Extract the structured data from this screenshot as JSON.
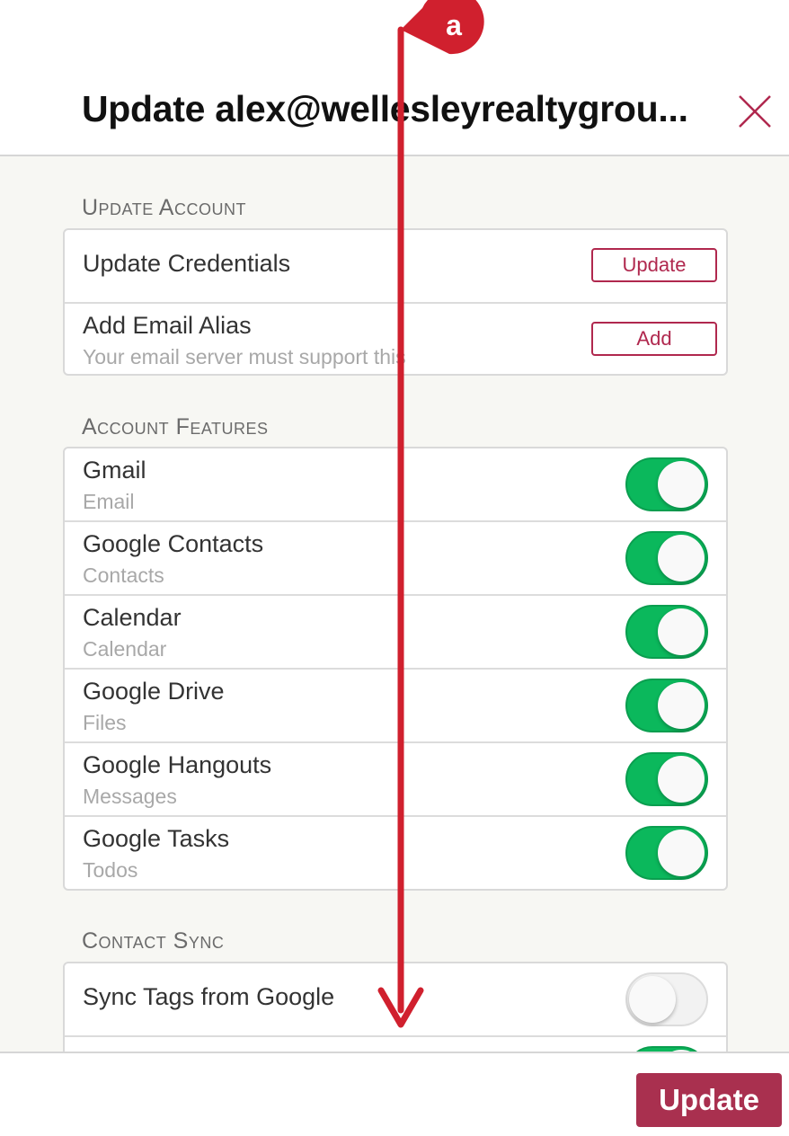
{
  "dialog": {
    "title": "Update alex@wellesleyrealtygrou..."
  },
  "sections": {
    "update_account": {
      "title": "Update Account",
      "rows": [
        {
          "label": "Update Credentials",
          "button": "Update"
        },
        {
          "label": "Add Email Alias",
          "sublabel": "Your email server must support this",
          "button": "Add"
        }
      ]
    },
    "account_features": {
      "title": "Account Features",
      "rows": [
        {
          "label": "Gmail",
          "sublabel": "Email",
          "enabled": true
        },
        {
          "label": "Google Contacts",
          "sublabel": "Contacts",
          "enabled": true
        },
        {
          "label": "Calendar",
          "sublabel": "Calendar",
          "enabled": true
        },
        {
          "label": "Google Drive",
          "sublabel": "Files",
          "enabled": true
        },
        {
          "label": "Google Hangouts",
          "sublabel": "Messages",
          "enabled": true
        },
        {
          "label": "Google Tasks",
          "sublabel": "Todos",
          "enabled": true
        }
      ]
    },
    "contact_sync": {
      "title": "Contact Sync",
      "rows": [
        {
          "label": "Sync Tags from Google",
          "enabled": false
        },
        {
          "label": "",
          "enabled": true
        }
      ]
    }
  },
  "footer": {
    "update_label": "Update"
  },
  "annotation": {
    "marker_label": "a",
    "color": "#d0202e"
  },
  "colors": {
    "accent": "#b0284e",
    "toggle_on": "#0bb85c",
    "primary_button": "#a9304f"
  }
}
